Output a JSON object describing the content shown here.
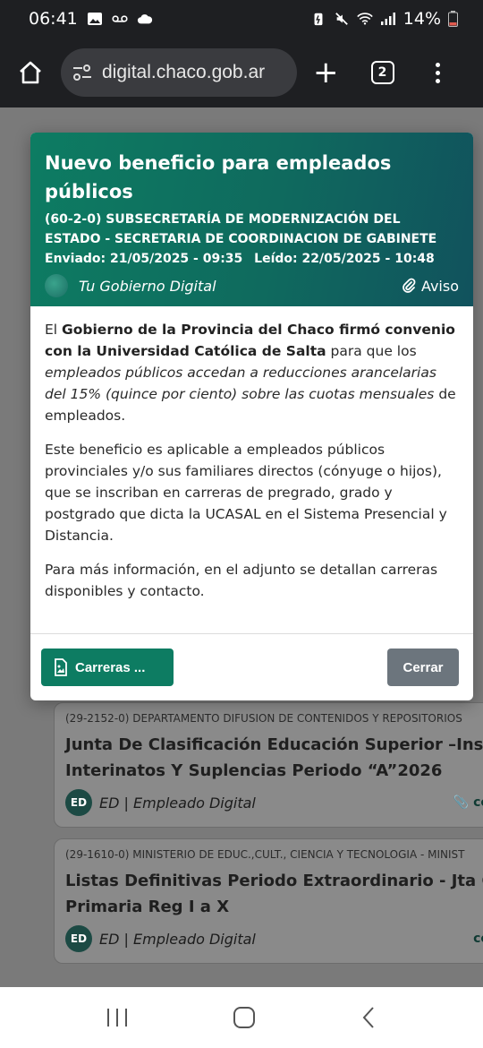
{
  "status_bar": {
    "time": "06:41",
    "battery": "14%",
    "icons": [
      "gallery-icon",
      "voicemail-icon",
      "cloud-icon",
      "battery-saver-icon",
      "mute-icon",
      "wifi-icon",
      "signal-icon",
      "battery-icon"
    ]
  },
  "browser": {
    "url": "digital.chaco.gob.ar",
    "tab_count": "2",
    "buttons": [
      "home-icon",
      "site-settings-icon",
      "new-tab-icon",
      "tabs-icon",
      "menu-icon"
    ]
  },
  "modal": {
    "title": "Nuevo beneficio para empleados públicos",
    "department": "(60-2-0) SUBSECRETARÍA DE MODERNIZACIÓN DEL ESTADO - SECRETARIA DE COORDINACION DE GABINETE",
    "sent": "Enviado: 21/05/2025 - 09:35",
    "read": "Leído: 22/05/2025 - 10:48",
    "source": "Tu Gobierno Digital",
    "tag": "Aviso",
    "paragraph1": {
      "a": "El ",
      "b": "Gobierno de la Provincia del Chaco firmó convenio con la Universidad Católica de Salta",
      "c": " para que los ",
      "d": "empleados públicos accedan a reducciones arancelarias del 15% (quince por ciento) sobre las cuotas mensuales",
      "e": " de empleados."
    },
    "paragraph2": "Este beneficio es aplicable a empleados públicos provinciales y/o sus familiares directos (cónyuge o hijos), que se inscriban en carreras de pregrado, grado y postgrado que dicta la UCASAL en el Sistema Presencial y Distancia.",
    "paragraph3": "Para más información, en el adjunto se detallan carreras disponibles y contacto.",
    "attachment_label": "Carreras ...",
    "close_label": "Cerrar",
    "colors": {
      "header_start": "#0d7c62",
      "header_end": "#11525d",
      "primary_button": "#0d7c62",
      "close_button": "#6c757d"
    }
  },
  "background_cards": [
    {
      "department": "(29-2152-0) DEPARTAMENTO DIFUSION DE CONTENIDOS Y REPOSITORIOS",
      "title_line1": "Junta De Clasificación Educación Superior –Insc",
      "title_line2": "Interinatos Y Suplencias Periodo “A”2026",
      "source": "ED | Empleado Digital",
      "tag": "co"
    },
    {
      "department": "(29-1610-0) MINISTERIO DE EDUC.,CULT., CIENCIA Y TECNOLOGIA - MINIST",
      "title_line1": "Listas Definitivas Periodo Extraordinario - Jta Cl",
      "title_line2": "Primaria Reg I a X",
      "source": "ED | Empleado Digital",
      "tag": "co"
    }
  ]
}
